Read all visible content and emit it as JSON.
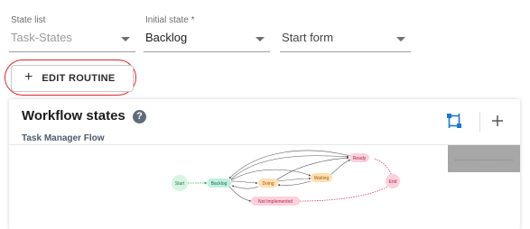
{
  "form": {
    "state_list_label": "State list",
    "state_list_value": "Task-States",
    "initial_state_label": "Initial state *",
    "initial_state_value": "Backlog",
    "start_form_placeholder": "Start form"
  },
  "edit_button_label": "EDIT ROUTINE",
  "card": {
    "title": "Workflow states",
    "subtitle": "Task Manager Flow",
    "help_icon": "?"
  },
  "diagram": {
    "nodes": {
      "start": "Start",
      "backlog": "Backlog",
      "doing": "Doing",
      "waiting": "Waiting",
      "ready": "Ready",
      "end": "End",
      "not_implemented": "Not Implemented"
    }
  },
  "colors": {
    "highlight_ring": "#e0262b",
    "routing_icon": "#1976d2"
  },
  "icons": [
    "chevron-down-icon",
    "plus-icon",
    "help-icon",
    "routing-icon",
    "add-icon"
  ]
}
